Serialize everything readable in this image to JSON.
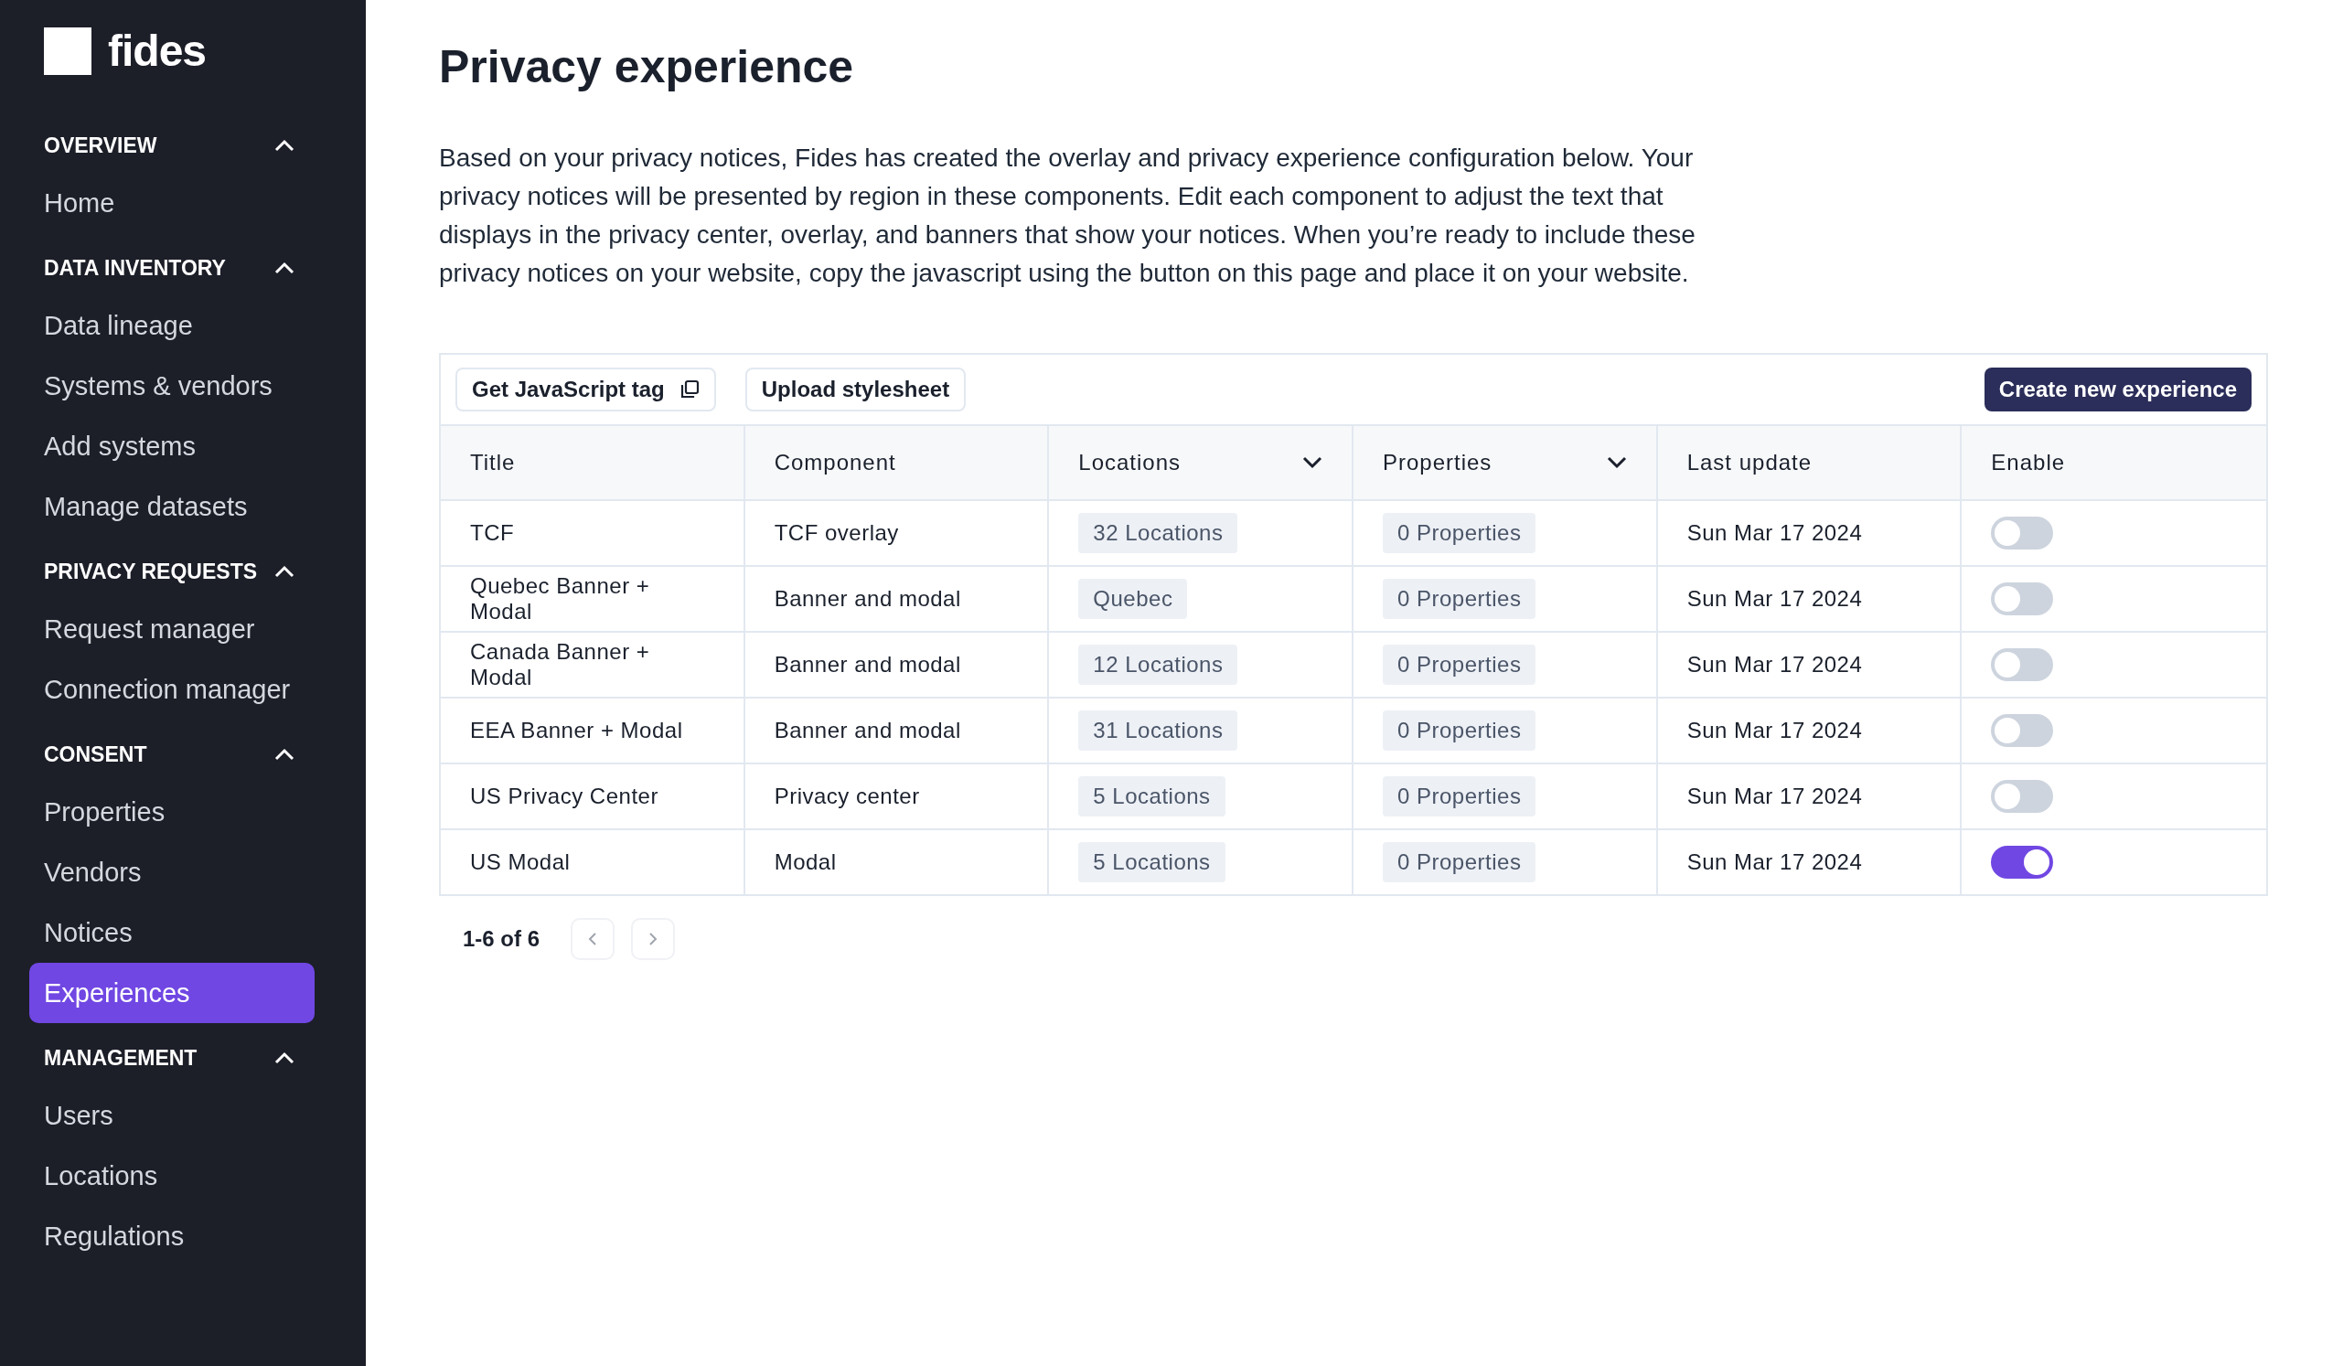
{
  "sidebar": {
    "logo": "fides",
    "sections": [
      {
        "title": "OVERVIEW",
        "expanded": true,
        "items": [
          {
            "label": "Home",
            "selected": false
          }
        ]
      },
      {
        "title": "DATA INVENTORY",
        "expanded": true,
        "items": [
          {
            "label": "Data lineage",
            "selected": false
          },
          {
            "label": "Systems & vendors",
            "selected": false
          },
          {
            "label": "Add systems",
            "selected": false
          },
          {
            "label": "Manage datasets",
            "selected": false
          }
        ]
      },
      {
        "title": "PRIVACY REQUESTS",
        "expanded": true,
        "items": [
          {
            "label": "Request manager",
            "selected": false
          },
          {
            "label": "Connection manager",
            "selected": false
          }
        ]
      },
      {
        "title": "CONSENT",
        "expanded": true,
        "items": [
          {
            "label": "Properties",
            "selected": false
          },
          {
            "label": "Vendors",
            "selected": false
          },
          {
            "label": "Notices",
            "selected": false
          },
          {
            "label": "Experiences",
            "selected": true
          }
        ]
      },
      {
        "title": "MANAGEMENT",
        "expanded": true,
        "items": [
          {
            "label": "Users",
            "selected": false
          },
          {
            "label": "Locations",
            "selected": false
          },
          {
            "label": "Regulations",
            "selected": false
          }
        ]
      }
    ]
  },
  "page": {
    "title": "Privacy experience",
    "description": "Based on your privacy notices, Fides has created the overlay and privacy experience configuration below. Your privacy notices will be presented by region in these components. Edit each component to adjust the text that displays in the privacy center, overlay, and banners that show your notices. When you’re ready to include these privacy notices on your website, copy the javascript using the button on this page and place it on your website."
  },
  "toolbar": {
    "buttons": [
      {
        "label": "Get JavaScript tag",
        "kind": "copy"
      },
      {
        "label": "Upload stylesheet",
        "kind": "plain"
      }
    ],
    "primary_button": "Create new experience"
  },
  "table": {
    "columns": [
      {
        "label": "Title",
        "kind": "plain"
      },
      {
        "label": "Component",
        "kind": "plain"
      },
      {
        "label": "Locations",
        "kind": "dropdown"
      },
      {
        "label": "Properties",
        "kind": "dropdown"
      },
      {
        "label": "Last update",
        "kind": "plain"
      },
      {
        "label": "Enable",
        "kind": "plain"
      }
    ],
    "rows": [
      {
        "title": "TCF",
        "component": "TCF overlay",
        "locations": "32 Locations",
        "properties": "0 Properties",
        "last_update": "Sun Mar 17 2024",
        "enabled": false
      },
      {
        "title": "Quebec Banner + Modal",
        "component": "Banner and modal",
        "locations": "Quebec",
        "properties": "0 Properties",
        "last_update": "Sun Mar 17 2024",
        "enabled": false
      },
      {
        "title": "Canada Banner + Modal",
        "component": "Banner and modal",
        "locations": "12 Locations",
        "properties": "0 Properties",
        "last_update": "Sun Mar 17 2024",
        "enabled": false
      },
      {
        "title": "EEA Banner + Modal",
        "component": "Banner and modal",
        "locations": "31 Locations",
        "properties": "0 Properties",
        "last_update": "Sun Mar 17 2024",
        "enabled": false
      },
      {
        "title": "US Privacy Center",
        "component": "Privacy center",
        "locations": "5 Locations",
        "properties": "0 Properties",
        "last_update": "Sun Mar 17 2024",
        "enabled": false
      },
      {
        "title": "US Modal",
        "component": "Modal",
        "locations": "5 Locations",
        "properties": "0 Properties",
        "last_update": "Sun Mar 17 2024",
        "enabled": true
      }
    ]
  },
  "pagination": {
    "range": "1-6 of 6"
  }
}
